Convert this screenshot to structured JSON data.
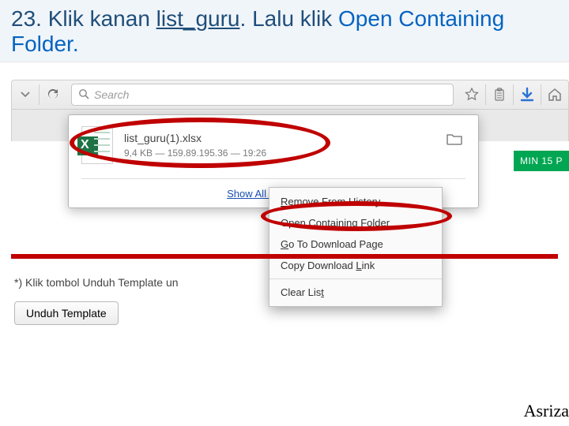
{
  "title": {
    "prefix": "23. Klik kanan ",
    "filename": "list_guru",
    "middle": ". Lalu klik ",
    "action": "Open Containing Folder",
    "suffix": "."
  },
  "toolbar": {
    "search_placeholder": "Search"
  },
  "download": {
    "filename": "list_guru(1).xlsx",
    "size": "9,4 KB",
    "host": "159.89.195.36",
    "time": "19:26",
    "sep1": " — ",
    "sep2": " — ",
    "show_all_prefix": "S",
    "show_all_label": "how All Downloads"
  },
  "context_menu": {
    "remove_pre": "R",
    "remove": "emove From History",
    "open_pre": "Open Containing ",
    "open_u": "F",
    "open_post": "older",
    "goto_pre": "G",
    "goto": "o To Download Page",
    "copy_pre": "Copy Download ",
    "copy_u": "L",
    "copy_post": "ink",
    "clear_pre": "Clear Lis",
    "clear_u": "t"
  },
  "note": "*) Klik tombol Unduh Template un",
  "unduh_label": "Unduh Template",
  "badge": "MIN 15 P",
  "footer": "Asriza"
}
